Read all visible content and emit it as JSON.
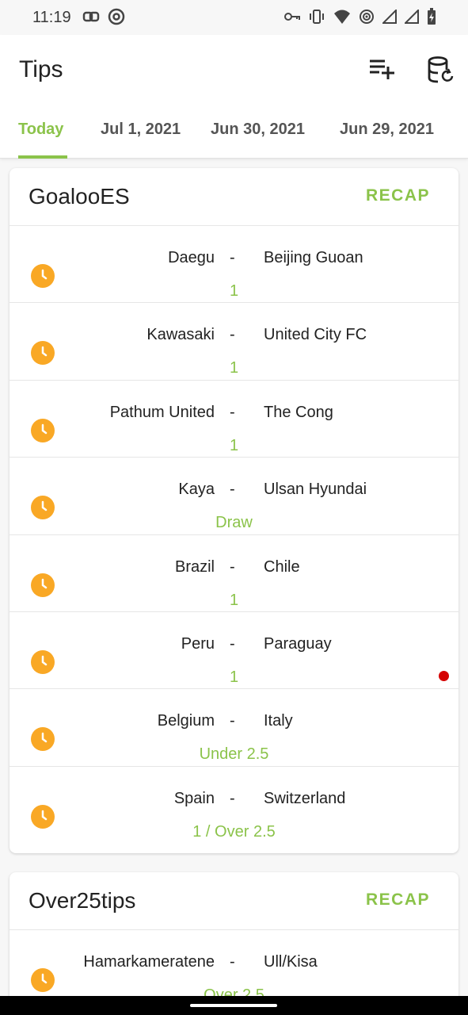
{
  "status_bar": {
    "time": "11:19",
    "left_icons": [
      "link-icon",
      "at-sign-icon"
    ],
    "right_icons": [
      "vpn-key-icon",
      "vibrate-icon",
      "wifi-icon",
      "hotspot-icon",
      "signal-icon",
      "signal-icon",
      "battery-charging-icon"
    ]
  },
  "app_bar": {
    "title": "Tips",
    "actions": [
      "playlist-add-icon",
      "database-sync-icon"
    ]
  },
  "tabs": [
    {
      "label": "Today",
      "active": true
    },
    {
      "label": "Jul 1, 2021",
      "active": false
    },
    {
      "label": "Jun 30, 2021",
      "active": false
    },
    {
      "label": "Jun 29, 2021",
      "active": false
    }
  ],
  "colors": {
    "accent": "#8bc34a",
    "clock": "#f9a825",
    "alert_dot": "#d50000"
  },
  "sections": [
    {
      "title": "GoalooES",
      "recap": "RECAP",
      "matches": [
        {
          "home": "Daegu",
          "sep": "-",
          "away": "Beijing Guoan",
          "tip": "1"
        },
        {
          "home": "Kawasaki",
          "sep": "-",
          "away": "United City FC",
          "tip": "1"
        },
        {
          "home": "Pathum United",
          "sep": "-",
          "away": "The Cong",
          "tip": "1"
        },
        {
          "home": "Kaya",
          "sep": "-",
          "away": "Ulsan Hyundai",
          "tip": "Draw"
        },
        {
          "home": "Brazil",
          "sep": "-",
          "away": "Chile",
          "tip": "1"
        },
        {
          "home": "Peru",
          "sep": "-",
          "away": "Paraguay",
          "tip": "1"
        },
        {
          "home": "Belgium",
          "sep": "-",
          "away": "Italy",
          "tip": "Under 2.5"
        },
        {
          "home": "Spain",
          "sep": "-",
          "away": "Switzerland",
          "tip": "1 / Over 2.5"
        }
      ]
    },
    {
      "title": "Over25tips",
      "recap": "RECAP",
      "matches": [
        {
          "home": "Hamarkameratene",
          "sep": "-",
          "away": "Ull/Kisa",
          "tip": "Over 2.5"
        }
      ]
    }
  ]
}
